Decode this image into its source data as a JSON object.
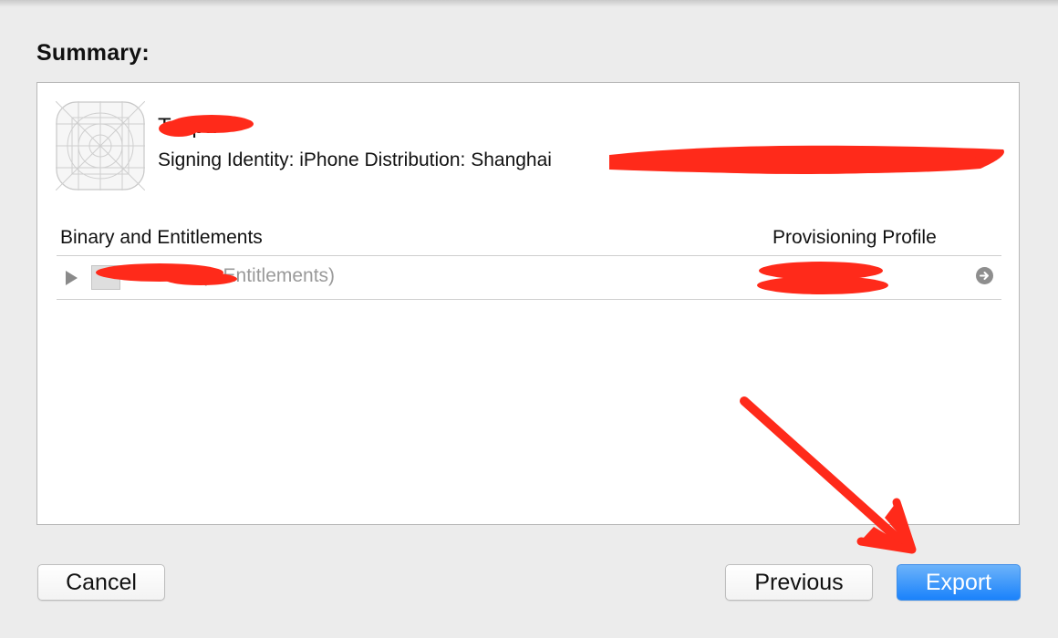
{
  "summary": {
    "title": "Summary:"
  },
  "app": {
    "name": "T...ipa",
    "signing_identity": "Signing Identity: iPhone Distribution: Shanghai",
    "icon": "app-icon-placeholder"
  },
  "table": {
    "headers": {
      "binary": "Binary and Entitlements",
      "profile": "Provisioning Profile"
    },
    "rows": [
      {
        "binary_name": "(4 Entitlements)",
        "profile": "",
        "disclosure": "disclosure-triangle-icon",
        "detail": "arrow-right-circle-icon"
      }
    ]
  },
  "buttons": {
    "cancel": "Cancel",
    "previous": "Previous",
    "export": "Export"
  },
  "colors": {
    "accent": "#1a82fb",
    "annotation": "#ff2a1a",
    "background": "#ececec"
  }
}
